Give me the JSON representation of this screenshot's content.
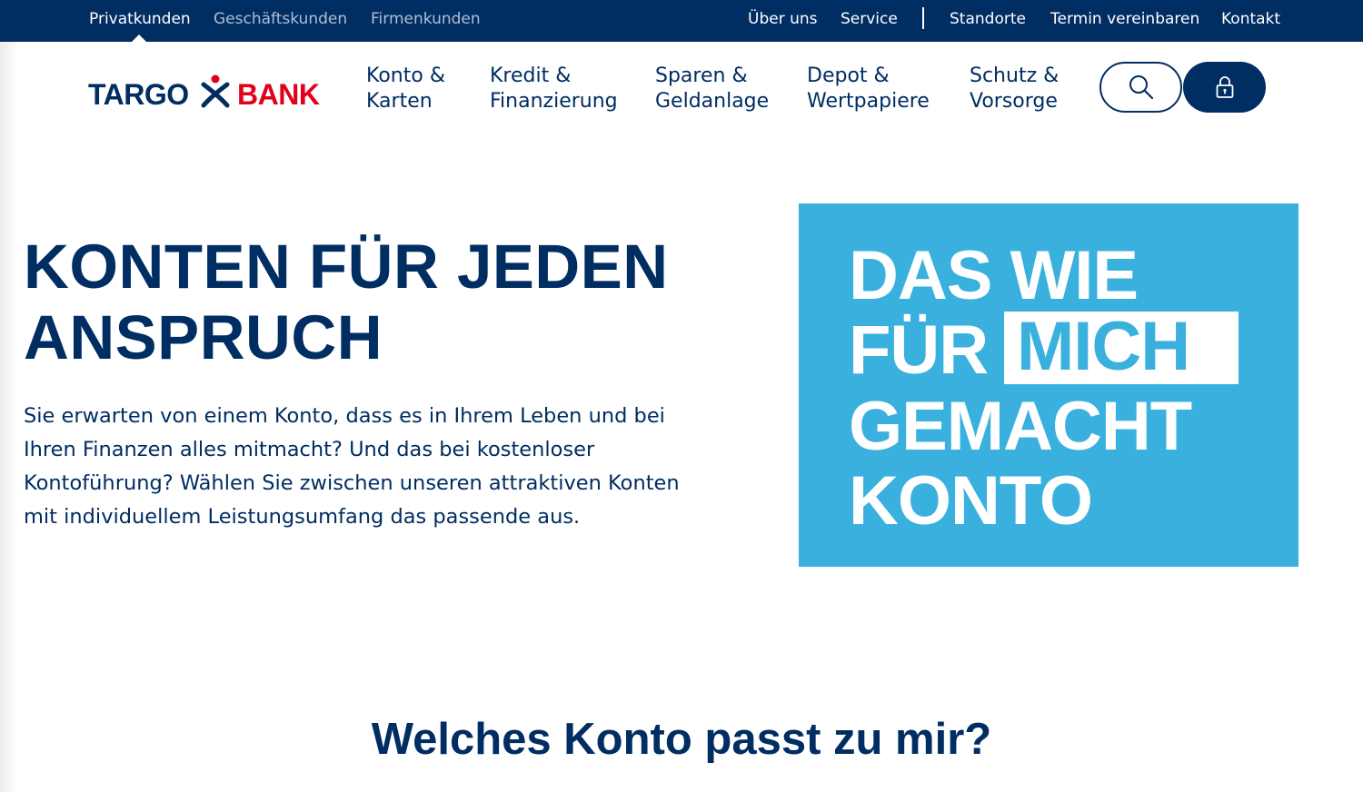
{
  "topbar": {
    "segments": [
      "Privatkunden",
      "Geschäftskunden",
      "Firmenkunden"
    ],
    "links": [
      "Über uns",
      "Service",
      "Standorte",
      "Termin vereinbaren",
      "Kontakt"
    ]
  },
  "logo": {
    "word1": "TARGO",
    "word2": "BANK"
  },
  "nav": [
    {
      "line1": "Konto &",
      "line2": "Karten"
    },
    {
      "line1": "Kredit &",
      "line2": "Finanzierung"
    },
    {
      "line1": "Sparen &",
      "line2": "Geldanlage"
    },
    {
      "line1": "Depot &",
      "line2": "Wertpapiere"
    },
    {
      "line1": "Schutz &",
      "line2": "Vorsorge"
    }
  ],
  "icons": {
    "search": "search-icon",
    "login": "lock-icon"
  },
  "hero": {
    "title": "KONTEN FÜR JEDEN ANSPRUCH",
    "text": "Sie erwarten von einem Konto, dass es in Ihrem Leben und bei Ihren Finanzen alles mitmacht? Und das bei kostenloser Kontoführung? Wählen Sie zwischen unseren attraktiven Konten mit individuellem Leistungsumfang das passende aus."
  },
  "promo": {
    "line1": "DAS WIE",
    "line2a": "FÜR",
    "line2b": "MICH",
    "line3": "GEMACHT",
    "line4": "KONTO"
  },
  "section": {
    "title": "Welches Konto passt zu mir?"
  },
  "colors": {
    "navy": "#002d62",
    "red": "#e2001a",
    "promo_blue": "#3ab0de"
  }
}
